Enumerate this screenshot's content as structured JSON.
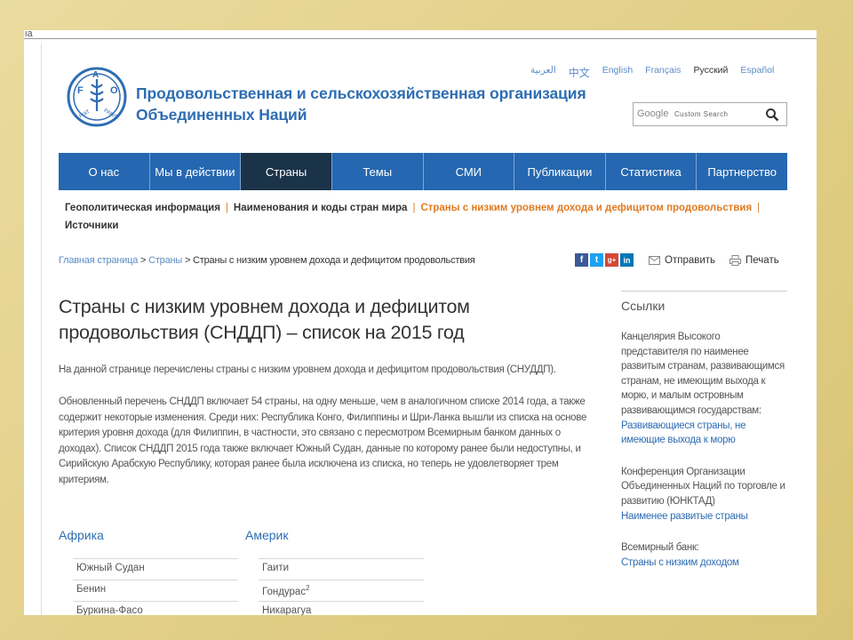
{
  "topbar": {
    "tiny_text": "ia"
  },
  "header": {
    "org_name_line1": "Продовольственная и сельскохозяйственная организация",
    "org_name_line2": "Объединенных Наций",
    "languages": [
      "العربية",
      "中文",
      "English",
      "Français",
      "Русский",
      "Español"
    ],
    "active_language": "Русский",
    "search_brand": "Google",
    "search_placeholder": "Custom Search"
  },
  "nav": {
    "items": [
      "О нас",
      "Мы в действии",
      "Страны",
      "Темы",
      "СМИ",
      "Публикации",
      "Статистика",
      "Партнерство"
    ],
    "active": "Страны"
  },
  "subnav": {
    "items": [
      "Геополитическая информация",
      "Наименования и коды стран мира",
      "Страны с низким уровнем дохода и дефицитом продовольствия",
      "Источники"
    ]
  },
  "breadcrumb": {
    "home": "Главная страница",
    "sep": ">",
    "countries": "Страны",
    "current": "Страны с низким уровнем дохода и дефицитом продовольствия"
  },
  "share": {
    "icons": [
      "f",
      "t",
      "g+",
      "in"
    ]
  },
  "actions": {
    "send": "Отправить",
    "print": "Печать"
  },
  "main": {
    "title": "Страны с низким уровнем дохода и дефицитом продовольствия (СНДДП) – список на 2015 год",
    "intro": "На данной странице перечислены страны с низким уровнем дохода и дефицитом продовольствия (СНУДДП).",
    "body": "Обновленный перечень СНДДП включает 54 страны, на одну меньше, чем в аналогичном списке 2014 года, а также содержит некоторые изменения. Среди них: Республика Конго, Филиппины и Шри-Ланка вышли из списка на основе критерия уровня дохода (для Филиппин, в частности, это связано с пересмотром Всемирным банком данных о доходах). Список СНДДП 2015 года также включает Южный Судан, данные по которому ранее были недоступны, и Сирийскую Арабскую Республику, которая ранее была исключена из списка, но теперь не удовлетворяет трем критериям."
  },
  "regions": {
    "africa": {
      "title": "Африка",
      "countries": [
        "Южный Судан",
        "Бенин",
        "Буркина-Фасо"
      ]
    },
    "america": {
      "title": "Америк",
      "countries": [
        "Гаити",
        "Гондурас",
        "Никарагуа"
      ],
      "footnote_on_second": "2"
    }
  },
  "sidebar": {
    "heading": "Ссылки",
    "blocks": [
      {
        "text": "Канцелярия Высокого представителя по наименее развитым странам, развивающимся странам, не имеющим выхода к морю, и малым островным развивающимся государствам:",
        "link": "Развивающиеся страны, не имеющие выхода к морю"
      },
      {
        "text": "Конференция Организации Объединенных Наций по торговле и развитию (ЮНКТАД)",
        "link": "Наименее развитые страны"
      },
      {
        "text": "Всемирный банк:",
        "link": "Страны с низким доходом"
      }
    ]
  },
  "colors": {
    "nav_bg": "#2567b0",
    "nav_active": "#1b3348",
    "link": "#2e6db3",
    "accent_orange": "#e07b20"
  }
}
